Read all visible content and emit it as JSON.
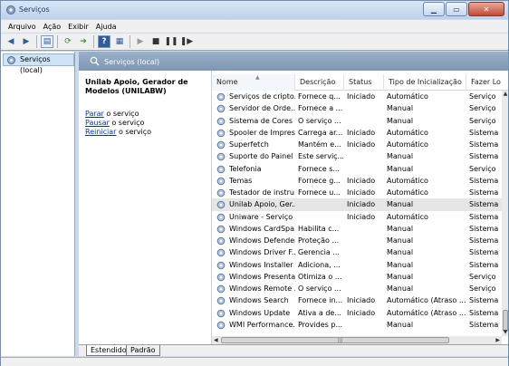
{
  "window": {
    "title": "Serviços"
  },
  "menu": [
    "Arquivo",
    "Ação",
    "Exibir",
    "Ajuda"
  ],
  "tree": {
    "item": "Serviços (local)"
  },
  "header": {
    "title": "Serviços (local)"
  },
  "description": {
    "service_name": "Unilab Apoio,  Gerador de Modelos (UNILABW)",
    "actions": [
      {
        "link": "Parar",
        "rest": " o serviço"
      },
      {
        "link": "Pausar",
        "rest": " o serviço"
      },
      {
        "link": "Reiniciar",
        "rest": " o serviço"
      }
    ]
  },
  "columns": [
    "Nome",
    "Descrição",
    "Status",
    "Tipo de Inicialização",
    "Fazer Lo"
  ],
  "rows": [
    {
      "name": "Serviços de cripto...",
      "desc": "Fornece q...",
      "status": "Iniciado",
      "start": "Automático",
      "logon": "Serviço"
    },
    {
      "name": "Servidor de Orde...",
      "desc": "Fornece a ...",
      "status": "",
      "start": "Manual",
      "logon": "Serviço"
    },
    {
      "name": "Sistema de Cores ...",
      "desc": "O serviço ...",
      "status": "",
      "start": "Manual",
      "logon": "Serviço"
    },
    {
      "name": "Spooler de Impres...",
      "desc": "Carrega ar...",
      "status": "Iniciado",
      "start": "Automático",
      "logon": "Sistema"
    },
    {
      "name": "Superfetch",
      "desc": "Mantém e...",
      "status": "Iniciado",
      "start": "Automático",
      "logon": "Sistema"
    },
    {
      "name": "Suporte do Painel ...",
      "desc": "Este serviç...",
      "status": "",
      "start": "Manual",
      "logon": "Sistema"
    },
    {
      "name": "Telefonia",
      "desc": "Fornece s...",
      "status": "",
      "start": "Manual",
      "logon": "Serviço"
    },
    {
      "name": "Temas",
      "desc": "Fornece g...",
      "status": "Iniciado",
      "start": "Automático",
      "logon": "Sistema"
    },
    {
      "name": "Testador de instru...",
      "desc": "Fornece u...",
      "status": "Iniciado",
      "start": "Automático",
      "logon": "Sistema"
    },
    {
      "name": "Unilab Apoio,  Ger...",
      "desc": "",
      "status": "Iniciado",
      "start": "Manual",
      "logon": "Sistema"
    },
    {
      "name": "Uniware - Serviço ...",
      "desc": "",
      "status": "Iniciado",
      "start": "Automático",
      "logon": "Sistema"
    },
    {
      "name": "Windows CardSpa...",
      "desc": "Habilita c...",
      "status": "",
      "start": "Manual",
      "logon": "Sistema"
    },
    {
      "name": "Windows Defender",
      "desc": "Proteção ...",
      "status": "",
      "start": "Manual",
      "logon": "Sistema"
    },
    {
      "name": "Windows Driver F...",
      "desc": "Gerencia ...",
      "status": "",
      "start": "Manual",
      "logon": "Sistema"
    },
    {
      "name": "Windows Installer",
      "desc": "Adiciona, ...",
      "status": "",
      "start": "Manual",
      "logon": "Sistema"
    },
    {
      "name": "Windows Presenta...",
      "desc": "Otimiza o ...",
      "status": "",
      "start": "Manual",
      "logon": "Serviço"
    },
    {
      "name": "Windows Remote ...",
      "desc": "O serviço ...",
      "status": "",
      "start": "Manual",
      "logon": "Serviço"
    },
    {
      "name": "Windows Search",
      "desc": "Fornece in...",
      "status": "Iniciado",
      "start": "Automático (Atraso ...",
      "logon": "Sistema"
    },
    {
      "name": "Windows Update",
      "desc": "Ativa a de...",
      "status": "Iniciado",
      "start": "Automático (Atraso ...",
      "logon": "Sistema"
    },
    {
      "name": "WMI Performance...",
      "desc": "Provides p...",
      "status": "",
      "start": "Manual",
      "logon": "Sistema"
    }
  ],
  "selected_row": 9,
  "tabs": [
    "Estendido",
    "Padrão"
  ],
  "icons": {
    "titlebar": "services-gear-icon",
    "toolbar": [
      "back-arrow-icon",
      "forward-arrow-icon",
      "show-console-tree-icon",
      "refresh-icon",
      "export-list-icon",
      "help-icon",
      "properties-icon",
      "start-service-icon",
      "stop-service-icon",
      "pause-service-icon",
      "restart-service-icon"
    ],
    "window_controls": [
      "minimize-icon",
      "maximize-icon",
      "close-icon"
    ]
  },
  "colors": {
    "header_band": "#8ea6c2",
    "link": "#0033cc",
    "selected_row": "#e6e6e6"
  }
}
